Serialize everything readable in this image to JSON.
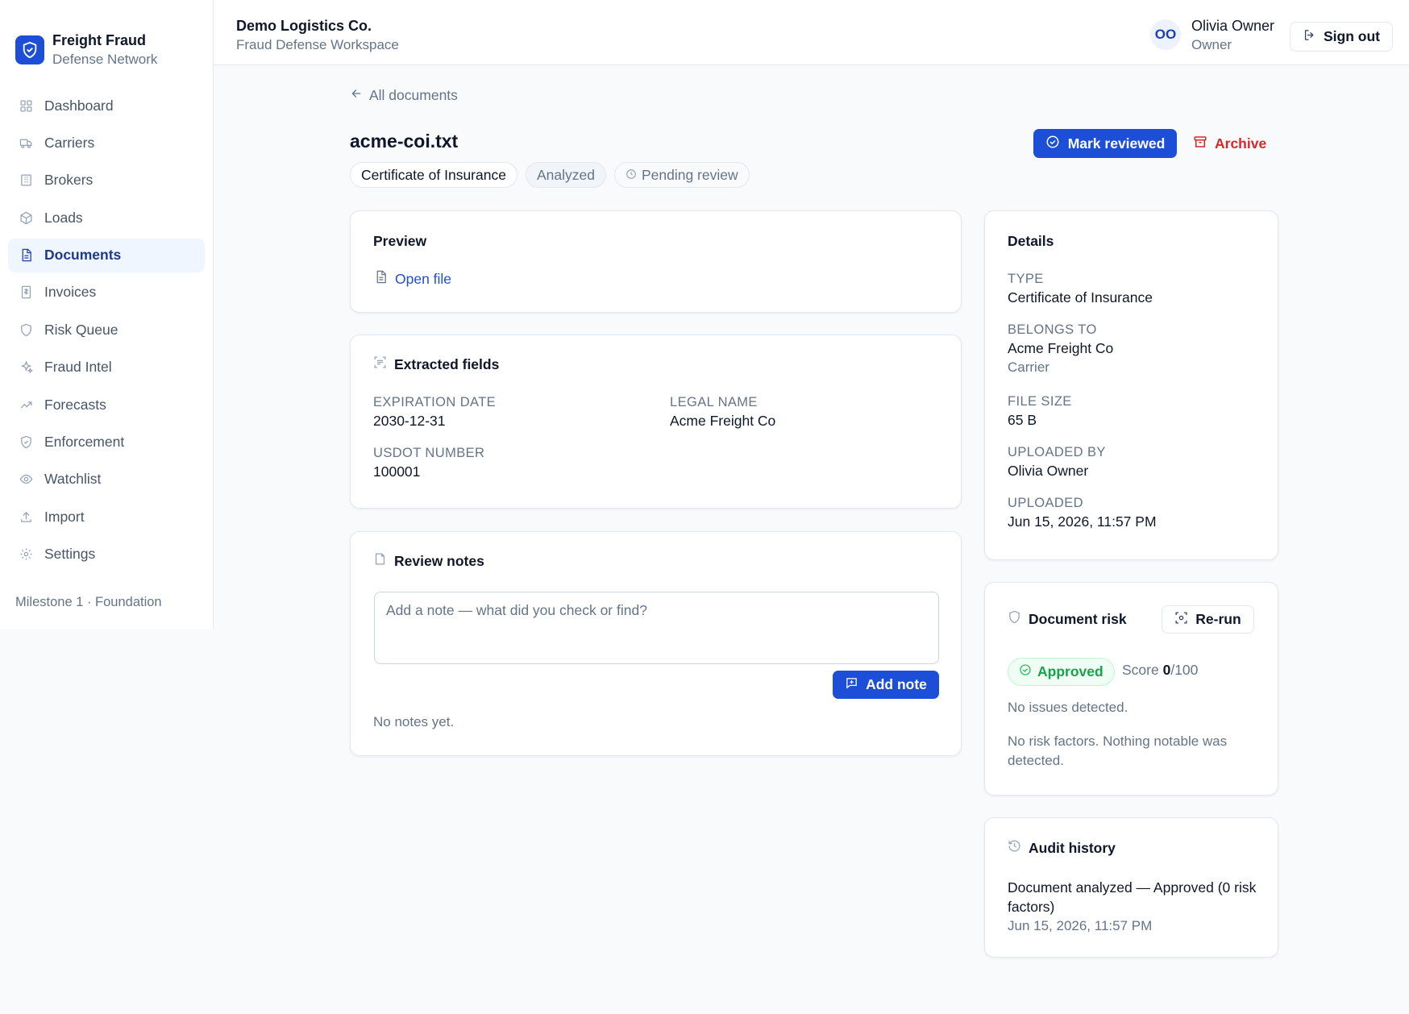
{
  "brand": {
    "title": "Freight Fraud",
    "subtitle": "Defense Network"
  },
  "sidebar": {
    "items": [
      {
        "label": "Dashboard",
        "icon": "grid-icon",
        "active": false
      },
      {
        "label": "Carriers",
        "icon": "truck-icon",
        "active": false
      },
      {
        "label": "Brokers",
        "icon": "building-icon",
        "active": false
      },
      {
        "label": "Loads",
        "icon": "package-icon",
        "active": false
      },
      {
        "label": "Documents",
        "icon": "document-icon",
        "active": true
      },
      {
        "label": "Invoices",
        "icon": "invoice-icon",
        "active": false
      },
      {
        "label": "Risk Queue",
        "icon": "shield-icon",
        "active": false
      },
      {
        "label": "Fraud Intel",
        "icon": "sparkles-icon",
        "active": false
      },
      {
        "label": "Forecasts",
        "icon": "trending-up-icon",
        "active": false
      },
      {
        "label": "Enforcement",
        "icon": "shield-check-icon",
        "active": false
      },
      {
        "label": "Watchlist",
        "icon": "eye-icon",
        "active": false
      },
      {
        "label": "Import",
        "icon": "upload-icon",
        "active": false
      },
      {
        "label": "Settings",
        "icon": "gear-icon",
        "active": false
      }
    ],
    "footer": "Milestone 1 · Foundation"
  },
  "header": {
    "org_name": "Demo Logistics Co.",
    "org_sub": "Fraud Defense Workspace",
    "avatar_initials": "OO",
    "user_name": "Olivia Owner",
    "user_role": "Owner",
    "signout_label": "Sign out"
  },
  "page": {
    "back_label": "All documents",
    "title": "acme-coi.txt",
    "badges": {
      "type": "Certificate of Insurance",
      "status": "Analyzed",
      "review": "Pending review"
    },
    "mark_reviewed_label": "Mark reviewed",
    "archive_label": "Archive"
  },
  "preview": {
    "title": "Preview",
    "open_file_label": "Open file"
  },
  "extracted": {
    "title": "Extracted fields",
    "fields": [
      {
        "label": "EXPIRATION DATE",
        "value": "2030-12-31"
      },
      {
        "label": "LEGAL NAME",
        "value": "Acme Freight Co"
      },
      {
        "label": "USDOT NUMBER",
        "value": "100001"
      }
    ]
  },
  "notes": {
    "title": "Review notes",
    "placeholder": "Add a note — what did you check or find?",
    "add_label": "Add note",
    "empty": "No notes yet."
  },
  "details": {
    "title": "Details",
    "type_label": "TYPE",
    "type_value": "Certificate of Insurance",
    "belongs_label": "BELONGS TO",
    "belongs_value": "Acme Freight Co",
    "belongs_sub": "Carrier",
    "size_label": "FILE SIZE",
    "size_value": "65 B",
    "uploaded_by_label": "UPLOADED BY",
    "uploaded_by_value": "Olivia Owner",
    "uploaded_label": "UPLOADED",
    "uploaded_value": "Jun 15, 2026, 11:57 PM"
  },
  "risk": {
    "title": "Document risk",
    "rerun_label": "Re-run",
    "status": "Approved",
    "score_prefix": "Score",
    "score_value": "0",
    "score_max": "/100",
    "issues": "No issues detected.",
    "factors": "No risk factors. Nothing notable was detected."
  },
  "audit": {
    "title": "Audit history",
    "entries": [
      {
        "text": "Document analyzed — Approved (0 risk factors)",
        "time": "Jun 15, 2026, 11:57 PM"
      }
    ]
  },
  "colors": {
    "primary": "#1d4ed8",
    "danger": "#dc2626",
    "success": "#16a34a",
    "active_nav_bg": "#eff6ff"
  }
}
